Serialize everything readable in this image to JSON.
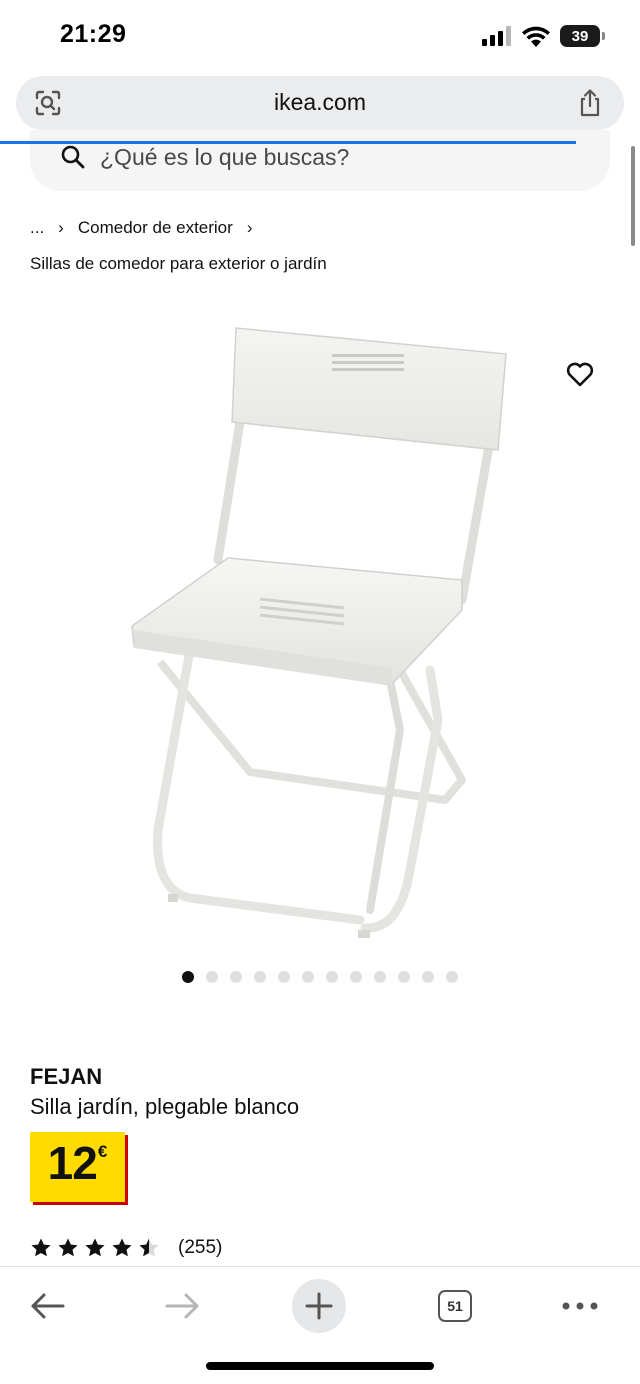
{
  "status_bar": {
    "time": "21:29",
    "battery_level": "39",
    "icons": [
      "cellular-signal-icon",
      "wifi-icon",
      "battery-icon"
    ]
  },
  "browser": {
    "url": "ikea.com",
    "left_icon": "page-search-icon",
    "right_icon": "share-icon",
    "load_progress": 0.9,
    "accent_color": "#1a73e8"
  },
  "search": {
    "placeholder": "¿Qué es lo que buscas?",
    "icon": "search-icon"
  },
  "breadcrumb": {
    "ellipsis": "...",
    "separator": "›",
    "parent": "Comedor de exterior",
    "current": "Sillas de comedor para exterior o jardín"
  },
  "product": {
    "image_icon": "folding-chair-image",
    "favorite_icon": "heart-icon",
    "carousel": {
      "total": 12,
      "active_index": 0
    },
    "name": "FEJAN",
    "description": "Silla jardín, plegable blanco",
    "price": {
      "value": "12",
      "currency": "€",
      "tag_color": "#ffdb00",
      "shadow_color": "#cc0008"
    },
    "rating": {
      "value": 4.5,
      "max": 5,
      "count_label": "(255)"
    }
  },
  "toolbar": {
    "back_icon": "arrow-left-icon",
    "forward_icon": "arrow-right-icon",
    "new_tab_icon": "plus-icon",
    "tab_count": "51",
    "more_icon": "more-dots-icon"
  }
}
